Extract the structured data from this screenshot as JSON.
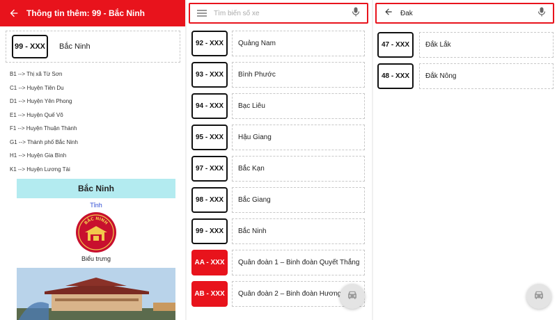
{
  "panel_detail": {
    "header": {
      "title": "Thông tin thêm: 99 - Bắc Ninh"
    },
    "plate": {
      "code": "99 - XXX",
      "province": "Bắc Ninh"
    },
    "district_codes": [
      "B1 --> Thị xã Từ Sơn",
      "C1 --> Huyện Tiên Du",
      "D1 --> Huyện Yên Phong",
      "E1 --> Huyện Quế Võ",
      "F1 --> Huyện Thuận Thành",
      "G1 --> Thành phố Bắc Ninh",
      "H1 --> Huyện Gia Bình",
      "K1 --> Huyện Lương Tài"
    ],
    "info_card": {
      "title": "Bắc Ninh",
      "subtitle": "Tỉnh",
      "emblem_caption": "Biểu trưng",
      "emblem_text": "BẮC NINH"
    }
  },
  "panel_list": {
    "search": {
      "placeholder": "Tìm biển số xe",
      "value": ""
    },
    "items": [
      {
        "code": "92 - XXX",
        "name": "Quảng Nam",
        "style": "normal"
      },
      {
        "code": "93 - XXX",
        "name": "Bình Phước",
        "style": "normal"
      },
      {
        "code": "94 - XXX",
        "name": "Bạc Liêu",
        "style": "normal"
      },
      {
        "code": "95 - XXX",
        "name": "Hậu Giang",
        "style": "normal"
      },
      {
        "code": "97 - XXX",
        "name": "Bắc Kạn",
        "style": "normal"
      },
      {
        "code": "98 - XXX",
        "name": "Bắc Giang",
        "style": "normal"
      },
      {
        "code": "99 - XXX",
        "name": "Bắc Ninh",
        "style": "normal"
      },
      {
        "code": "AA - XXX",
        "name": "Quân đoàn 1 – Binh đoàn Quyết Thắng",
        "style": "military"
      },
      {
        "code": "AB - XXX",
        "name": "Quân đoàn 2 – Binh đoàn Hương Giang",
        "style": "military"
      }
    ]
  },
  "panel_search": {
    "search": {
      "value": "Đak"
    },
    "items": [
      {
        "code": "47 - XXX",
        "name": "Đắk Lắk"
      },
      {
        "code": "48 - XXX",
        "name": "Đắk Nông"
      }
    ]
  },
  "colors": {
    "brand_red": "#e8131c",
    "info_title_bg": "#b3ebf0",
    "subtitle_blue": "#2d4bd3"
  },
  "icons": {
    "back": "arrow-left-icon",
    "menu": "hamburger-menu-icon",
    "mic": "microphone-icon",
    "fab": "car-icon"
  }
}
